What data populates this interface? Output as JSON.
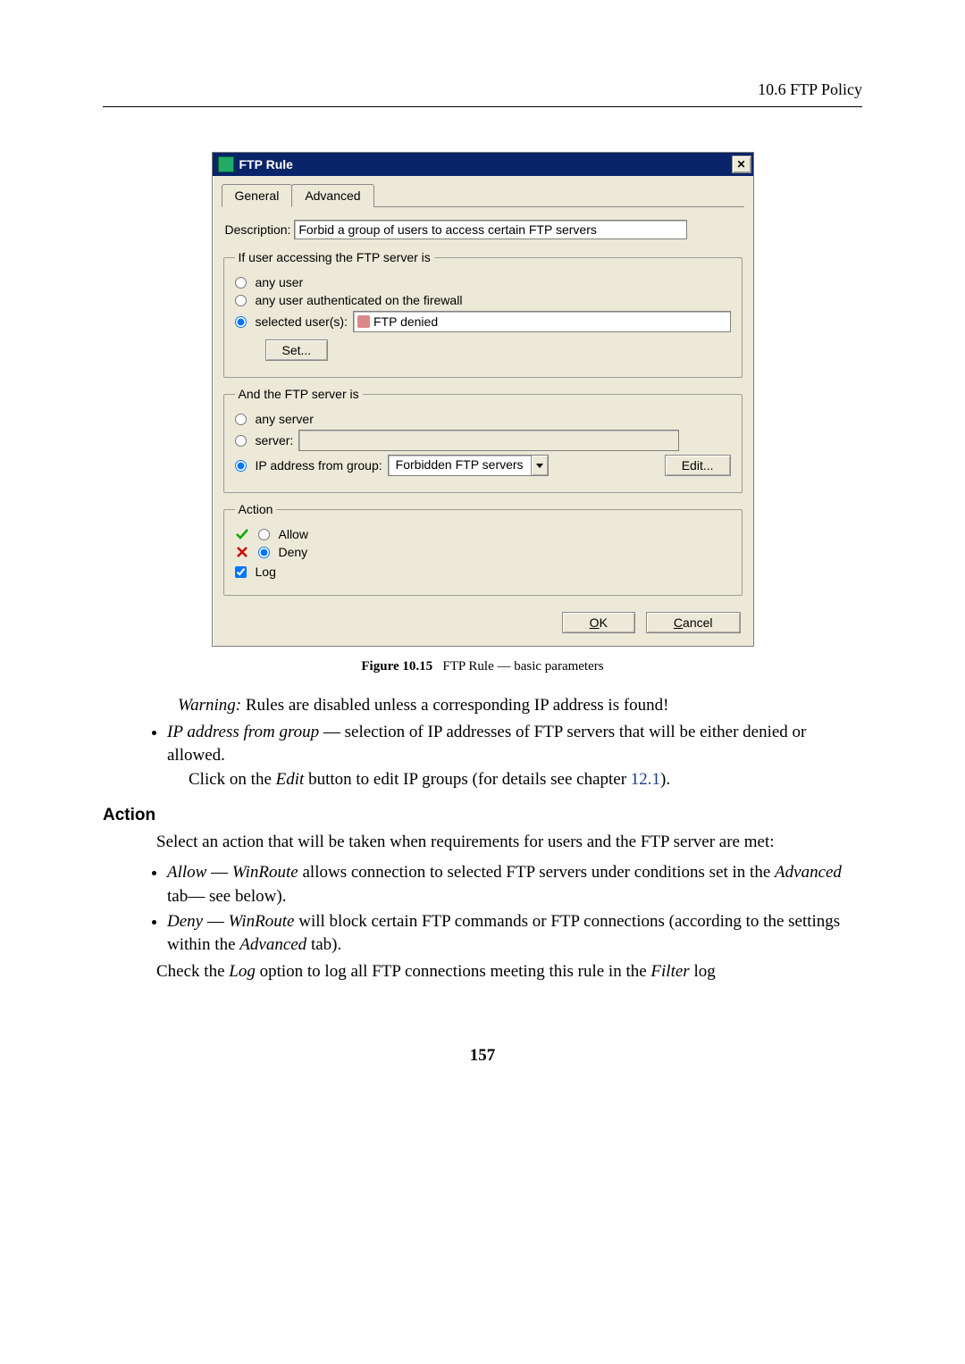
{
  "header": {
    "section": "10.6 FTP Policy"
  },
  "dialog": {
    "title": "FTP Rule",
    "tabs": {
      "general": "General",
      "advanced": "Advanced"
    },
    "description": {
      "label": "Description:",
      "value": "Forbid a group of users to access certain FTP servers"
    },
    "user_group": {
      "legend": "If user accessing the FTP server is",
      "opt_any": "any user",
      "opt_authenticated": "any user authenticated on the firewall",
      "opt_selected": "selected user(s):",
      "selected_value": "FTP denied",
      "set_btn": "Set..."
    },
    "server_group": {
      "legend": "And the FTP server is",
      "opt_any": "any server",
      "opt_server": "server:",
      "opt_group": "IP address from group:",
      "group_value": "Forbidden FTP servers",
      "edit_btn": "Edit..."
    },
    "action_group": {
      "legend": "Action",
      "allow": "Allow",
      "deny": "Deny",
      "log": "Log"
    },
    "ok": "OK",
    "cancel": "Cancel"
  },
  "figure": {
    "label": "Figure 10.15",
    "caption": "FTP Rule — basic parameters"
  },
  "text": {
    "warning_label": "Warning:",
    "warning": " Rules are disabled unless a corresponding IP address is found!",
    "ip_group_term": "IP address from group",
    "ip_group_rest": " — selection of IP addresses of FTP servers that will be either denied or allowed.",
    "click_edit_1": "Click on the ",
    "click_edit_em": "Edit",
    "click_edit_2": " button to edit IP groups (for details see chapter ",
    "chapter_ref": "12.1",
    "click_edit_3": ").",
    "action_head": "Action",
    "action_intro": "Select an action that will be taken when requirements for users and the FTP server are met:",
    "allow_term": "Allow",
    "allow_em": "WinRoute",
    "allow_rest1": " allows connection to selected FTP servers under conditions set in the ",
    "allow_em2": "Advanced",
    "allow_rest2": " tab— see below).",
    "deny_term": "Deny",
    "deny_em": "WinRoute",
    "deny_rest1": " will block certain FTP commands or FTP connections (according to the settings within the ",
    "deny_em2": "Advanced",
    "deny_rest2": " tab).",
    "check_log_1": "Check the ",
    "check_log_em1": "Log",
    "check_log_2": " option to log all FTP connections meeting this rule in the ",
    "check_log_em2": "Filter",
    "check_log_3": " log"
  },
  "page_number": "157"
}
